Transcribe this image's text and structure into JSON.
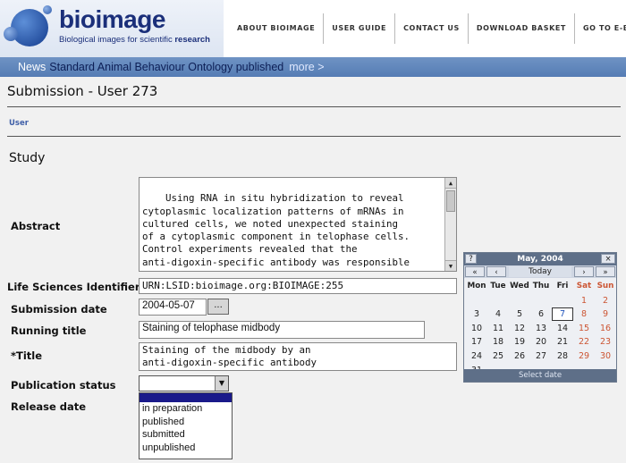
{
  "header": {
    "logo_word": "bioimage",
    "logo_tag_plain": "Biological images for scientific ",
    "logo_tag_bold": "research",
    "nav": [
      "ABOUT BIOIMAGE",
      "USER GUIDE",
      "CONTACT US",
      "DOWNLOAD BASKET",
      "GO TO E-BIOSCI"
    ]
  },
  "news": {
    "label": "News",
    "text": "Standard Animal Behaviour Ontology published",
    "more": "more >"
  },
  "page": {
    "title": "Submission - User 273",
    "breadcrumb": "User",
    "section": "Study"
  },
  "form": {
    "abstract_label": "Abstract",
    "abstract_value": "Using RNA in situ hybridization to reveal\ncytoplasmic localization patterns of mRNAs in\ncultured cells, we noted unexpected staining\nof a cytoplasmic component in telophase cells.\nControl experiments revealed that the\nanti-digoxin-specific antibody was responsible\nfor this staining. Because the staining was",
    "lsid_label": "Life Sciences Identifier",
    "lsid_value": "URN:LSID:bioimage.org:BIOIMAGE:255",
    "date_label": "Submission date",
    "date_value": "2004-05-07",
    "date_button": "...",
    "running_title_label": "Running title",
    "running_title_value": "Staining of telophase midbody",
    "title_label": "*Title",
    "title_value": "Staining of the midbody by an\nanti-digoxin-specific antibody",
    "pub_status_label": "Publication status",
    "pub_status_value": "",
    "pub_status_options": [
      "",
      "in preparation",
      "published",
      "submitted",
      "unpublished"
    ],
    "release_date_label": "Release date"
  },
  "calendar": {
    "help": "?",
    "month": "May, 2004",
    "close": "×",
    "prev_year": "«",
    "prev_month": "‹",
    "today": "Today",
    "next_month": "›",
    "next_year": "»",
    "dow": [
      "Mon",
      "Tue",
      "Wed",
      "Thu",
      "Fri",
      "Sat",
      "Sun"
    ],
    "weeks": [
      [
        "",
        "",
        "",
        "",
        "",
        "1",
        "2"
      ],
      [
        "3",
        "4",
        "5",
        "6",
        "7",
        "8",
        "9"
      ],
      [
        "10",
        "11",
        "12",
        "13",
        "14",
        "15",
        "16"
      ],
      [
        "17",
        "18",
        "19",
        "20",
        "21",
        "22",
        "23"
      ],
      [
        "24",
        "25",
        "26",
        "27",
        "28",
        "29",
        "30"
      ],
      [
        "31",
        "",
        "",
        "",
        "",
        "",
        ""
      ]
    ],
    "selected_day": "7",
    "footer": "Select date",
    "weekend_color": "#cc5533",
    "header_color": "#5e6f88"
  },
  "colors": {
    "news_bar": "#557cb4",
    "brand": "#1b2f7a",
    "page_bg": "#f1f1f1"
  }
}
